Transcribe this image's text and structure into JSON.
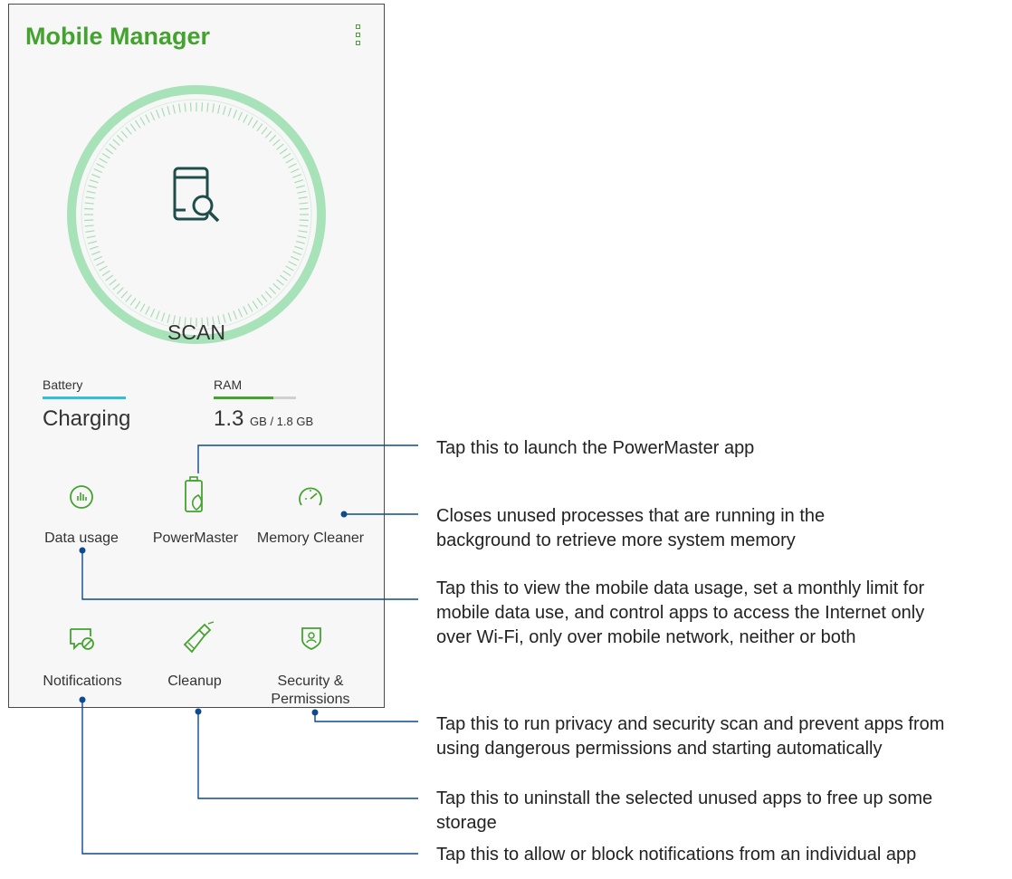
{
  "app": {
    "title": "Mobile Manager"
  },
  "scan": {
    "label": "SCAN"
  },
  "battery": {
    "label": "Battery",
    "value": "Charging",
    "level": 1.0,
    "color": "#33bfd4"
  },
  "ram": {
    "label": "RAM",
    "used": "1.3",
    "total_text": "GB / 1.8 GB",
    "usage_fraction": 0.72,
    "color": "#43a32e"
  },
  "tools": [
    {
      "label": "Data usage",
      "icon": "bar-chart-circle-icon"
    },
    {
      "label": "PowerMaster",
      "icon": "battery-leaf-icon"
    },
    {
      "label": "Memory Cleaner",
      "icon": "speedometer-icon"
    },
    {
      "label": "Notifications",
      "icon": "notification-block-icon"
    },
    {
      "label": "Cleanup",
      "icon": "broom-icon"
    },
    {
      "label": "Security &",
      "label_line2": "Permissions",
      "icon": "shield-user-icon"
    }
  ],
  "callouts": {
    "powermaster": "Tap this to launch the PowerMaster app",
    "memory_cleaner": [
      "Closes unused processes that are running in the",
      "background to retrieve more system memory"
    ],
    "data_usage": [
      "Tap this to view the mobile data usage, set a monthly limit for",
      "mobile data use, and control apps to access the Internet only",
      "over Wi-Fi, only over mobile network, neither or both"
    ],
    "security": [
      "Tap this to run privacy and security scan and prevent apps from",
      "using dangerous permissions and starting automatically"
    ],
    "cleanup": [
      "Tap this to uninstall the selected unused apps to free up some",
      "storage"
    ],
    "notifications": "Tap this to allow or block notifications from an individual app"
  },
  "colors": {
    "accent": "#43a32e",
    "callout_line": "#0d4b8c",
    "ring": "#9fdcb0"
  }
}
